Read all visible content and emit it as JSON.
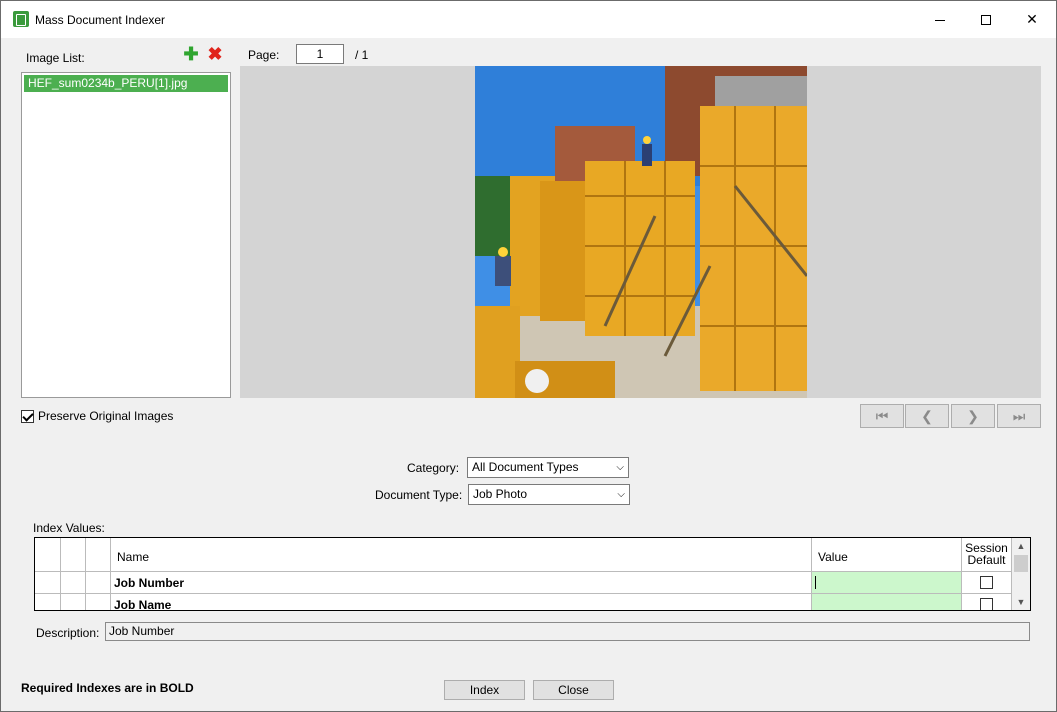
{
  "window": {
    "title": "Mass Document Indexer",
    "icon": "document-indexer-app-icon"
  },
  "image_list": {
    "label": "Image List:",
    "items": [
      "HEF_sum0234b_PERU[1].jpg"
    ],
    "selected_index": 0,
    "add_icon": "plus-icon",
    "remove_icon": "x-icon"
  },
  "page": {
    "label": "Page:",
    "current": "1",
    "total": "/ 1"
  },
  "preserve": {
    "label": "Preserve Original Images",
    "checked": true
  },
  "nav": {
    "first_icon": "first-page-icon",
    "prev_icon": "previous-page-icon",
    "next_icon": "next-page-icon",
    "last_icon": "last-page-icon"
  },
  "category": {
    "label": "Category:",
    "value": "All Document Types"
  },
  "document_type": {
    "label": "Document Type:",
    "value": "Job Photo"
  },
  "index_values": {
    "label": "Index Values:",
    "columns": {
      "name": "Name",
      "value": "Value",
      "session_default": "Session Default"
    },
    "rows": [
      {
        "name": "Job Number",
        "value": "",
        "session_default": false
      },
      {
        "name": "Job Name",
        "value": "",
        "session_default": false
      }
    ]
  },
  "description": {
    "label": "Description:",
    "value": "Job Number"
  },
  "footer": {
    "required_note": "Required Indexes are in BOLD",
    "index_button": "Index",
    "close_button": "Close"
  },
  "colors": {
    "selection_green": "#4caf50",
    "value_cell_green": "#ccf7cc",
    "add_green": "#2fa52f",
    "remove_red": "#e0241b"
  }
}
